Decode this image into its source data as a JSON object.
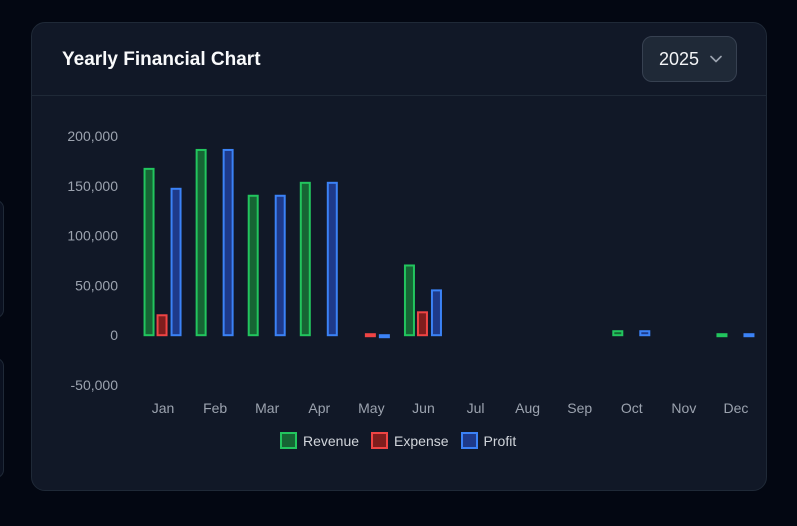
{
  "card": {
    "title": "Yearly Financial Chart",
    "year_select": {
      "value": "2025",
      "icon": "chevron-down-icon"
    }
  },
  "colors": {
    "revenue": "#22c55e",
    "expense": "#ef4444",
    "profit": "#3b82f6"
  },
  "chart_data": {
    "type": "bar",
    "categories": [
      "Jan",
      "Feb",
      "Mar",
      "Apr",
      "May",
      "Jun",
      "Jul",
      "Aug",
      "Sep",
      "Oct",
      "Nov",
      "Dec"
    ],
    "series": [
      {
        "name": "Revenue",
        "values": [
          167000,
          186000,
          140000,
          153000,
          0,
          70000,
          0,
          0,
          0,
          4000,
          0,
          1000
        ]
      },
      {
        "name": "Expense",
        "values": [
          20000,
          0,
          0,
          0,
          1000,
          23000,
          0,
          0,
          0,
          0,
          0,
          0
        ]
      },
      {
        "name": "Profit",
        "values": [
          147000,
          186000,
          140000,
          153000,
          -1000,
          45000,
          0,
          0,
          0,
          4000,
          0,
          1000
        ]
      }
    ],
    "ylim": [
      -50000,
      200000
    ],
    "yticks": [
      "200,000",
      "150,000",
      "100,000",
      "50,000",
      "0",
      "-50,000"
    ],
    "ytick_values": [
      200000,
      150000,
      100000,
      50000,
      0,
      -50000
    ],
    "grid": false,
    "legend": "bottom-center"
  }
}
